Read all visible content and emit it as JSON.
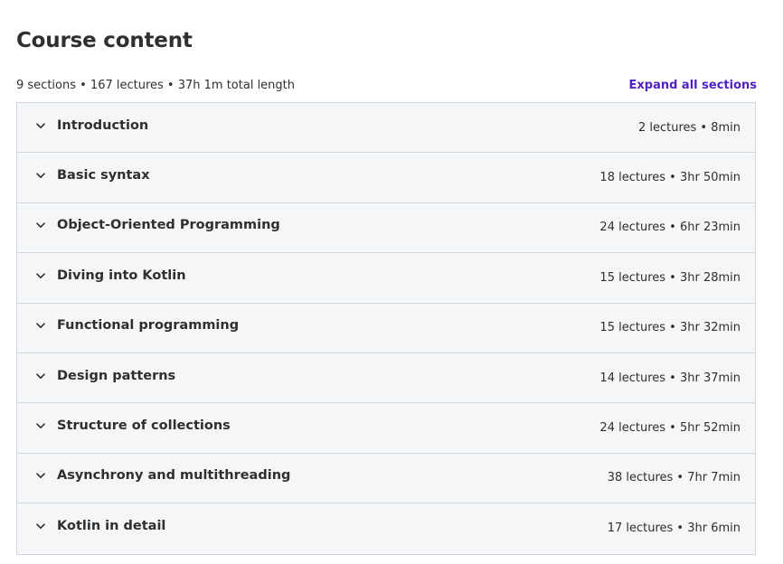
{
  "header": {
    "title": "Course content",
    "summary": "9 sections • 167 lectures • 37h 1m total length",
    "expand_label": "Expand all sections"
  },
  "colors": {
    "accent": "#5022c3",
    "row_background": "#f5f6f7",
    "border": "#d1d7dc",
    "text": "#2d2f31"
  },
  "icons": {
    "section_toggle": "chevron-down-icon"
  },
  "sections": [
    {
      "title": "Introduction",
      "meta": "2 lectures • 8min"
    },
    {
      "title": "Basic syntax",
      "meta": "18 lectures • 3hr 50min"
    },
    {
      "title": "Object-Oriented Programming",
      "meta": "24 lectures • 6hr 23min"
    },
    {
      "title": "Diving into Kotlin",
      "meta": "15 lectures • 3hr 28min"
    },
    {
      "title": "Functional programming",
      "meta": "15 lectures • 3hr 32min"
    },
    {
      "title": "Design patterns",
      "meta": "14 lectures • 3hr 37min"
    },
    {
      "title": "Structure of collections",
      "meta": "24 lectures • 5hr 52min"
    },
    {
      "title": "Asynchrony and multithreading",
      "meta": "38 lectures • 7hr 7min"
    },
    {
      "title": "Kotlin in detail",
      "meta": "17 lectures • 3hr 6min"
    }
  ]
}
